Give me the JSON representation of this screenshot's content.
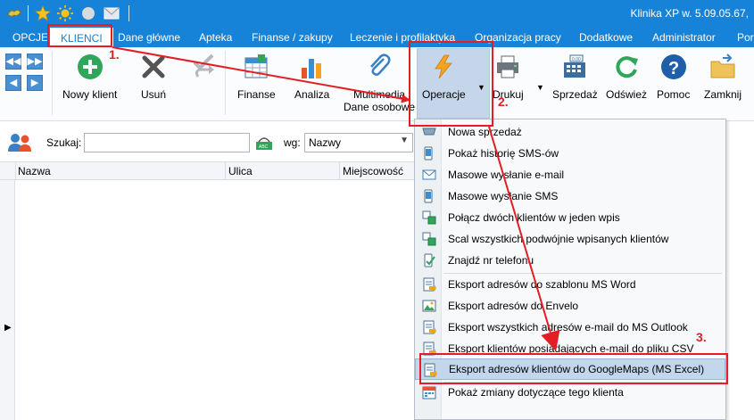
{
  "titlebar": {
    "title": "Klinika XP w. 5.09.05.67,",
    "icons": [
      "app-icon",
      "star-icon",
      "sun-icon",
      "circle-icon",
      "mail-icon"
    ]
  },
  "tabs": [
    "OPCJE",
    "KLIENCI",
    "Dane główne",
    "Apteka",
    "Finanse / zakupy",
    "Leczenie i profilaktyka",
    "Organizacja pracy",
    "Dodatkowe",
    "Administrator",
    "Por"
  ],
  "active_tab": "KLIENCI",
  "ribbon": {
    "nowy_klient": "Nowy klient",
    "usun": "Usuń",
    "finanse": "Finanse",
    "analiza": "Analiza",
    "multimedia": "Multimedia",
    "dane_osobowe": "Dane osobowe",
    "operacje": "Operacje",
    "drukuj": "Drukuj",
    "sprzedaz": "Sprzedaż",
    "odswiez": "Odśwież",
    "pomoc": "Pomoc",
    "zamknij": "Zamknij"
  },
  "search": {
    "label": "Szukaj:",
    "value": "",
    "wg_label": "wg:",
    "wg_value": "Nazwy"
  },
  "table": {
    "columns": [
      "Nazwa",
      "Ulica",
      "Miejscowość"
    ]
  },
  "menu": {
    "items": [
      "Nowa sprzedaż",
      "Pokaż historię SMS-ów",
      "Masowe wysłanie e-mail",
      "Masowe wysłanie SMS",
      "Połącz dwóch klientów w jeden wpis",
      "Scal wszystkich podwójnie wpisanych klientów",
      "Znajdź nr telefonu",
      "Eksport adresów do szablonu MS Word",
      "Eksport adresów do Envelo",
      "Eksport wszystkich adresów e-mail do MS Outlook",
      "Eksport klientów posiadających e-mail do pliku CSV",
      "Eksport adresów klientów do GoogleMaps (MS Excel)",
      "Pokaż zmiany dotyczące tego klienta"
    ],
    "highlighted_index": 11
  },
  "annotations": {
    "step1": "1.",
    "step2": "2.",
    "step3": "3."
  },
  "colors": {
    "titlebar": "#1683d8",
    "annotation": "#e31e24",
    "highlight": "#c2d7ee"
  }
}
